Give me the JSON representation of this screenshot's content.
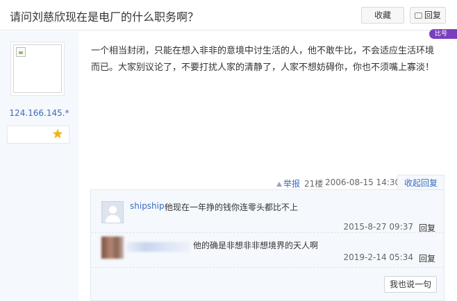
{
  "header": {
    "title": "请问刘慈欣现在是电厂的什么职务啊？",
    "collect_label": "收藏",
    "reply_label": "回复"
  },
  "corner_badge": {
    "text": "比号"
  },
  "author": {
    "ip": "124.166.145.*",
    "level_icon": "star-icon"
  },
  "post": {
    "content": "一个相当封闭，只能在想入非非的意境中讨生活的人，他不敢牛比，不会适应生活环境而已。大家别议论了，不要打扰人家的清静了，人家不想妨碍你，你也不须嘴上寡淡！",
    "report_label": "举报",
    "floor": "21楼",
    "timestamp": "2006-08-15 14:30",
    "collapse_label": "收起回复"
  },
  "replies": [
    {
      "user": "shipship:",
      "content": "他现在一年挣的钱你连零头都比不上",
      "time": "2015-8-27 09:37",
      "reply_label": "回复"
    },
    {
      "user": "",
      "content": "他的确是非想非非想境界的天人啊",
      "time": "2019-2-14 05:34",
      "reply_label": "回复"
    }
  ],
  "say_label": "我也说一句",
  "colors": {
    "link": "#3a6cbf",
    "sidebar_bg": "#f5f8fc",
    "badge": "#7a3fbf",
    "star": "#f5b400"
  }
}
